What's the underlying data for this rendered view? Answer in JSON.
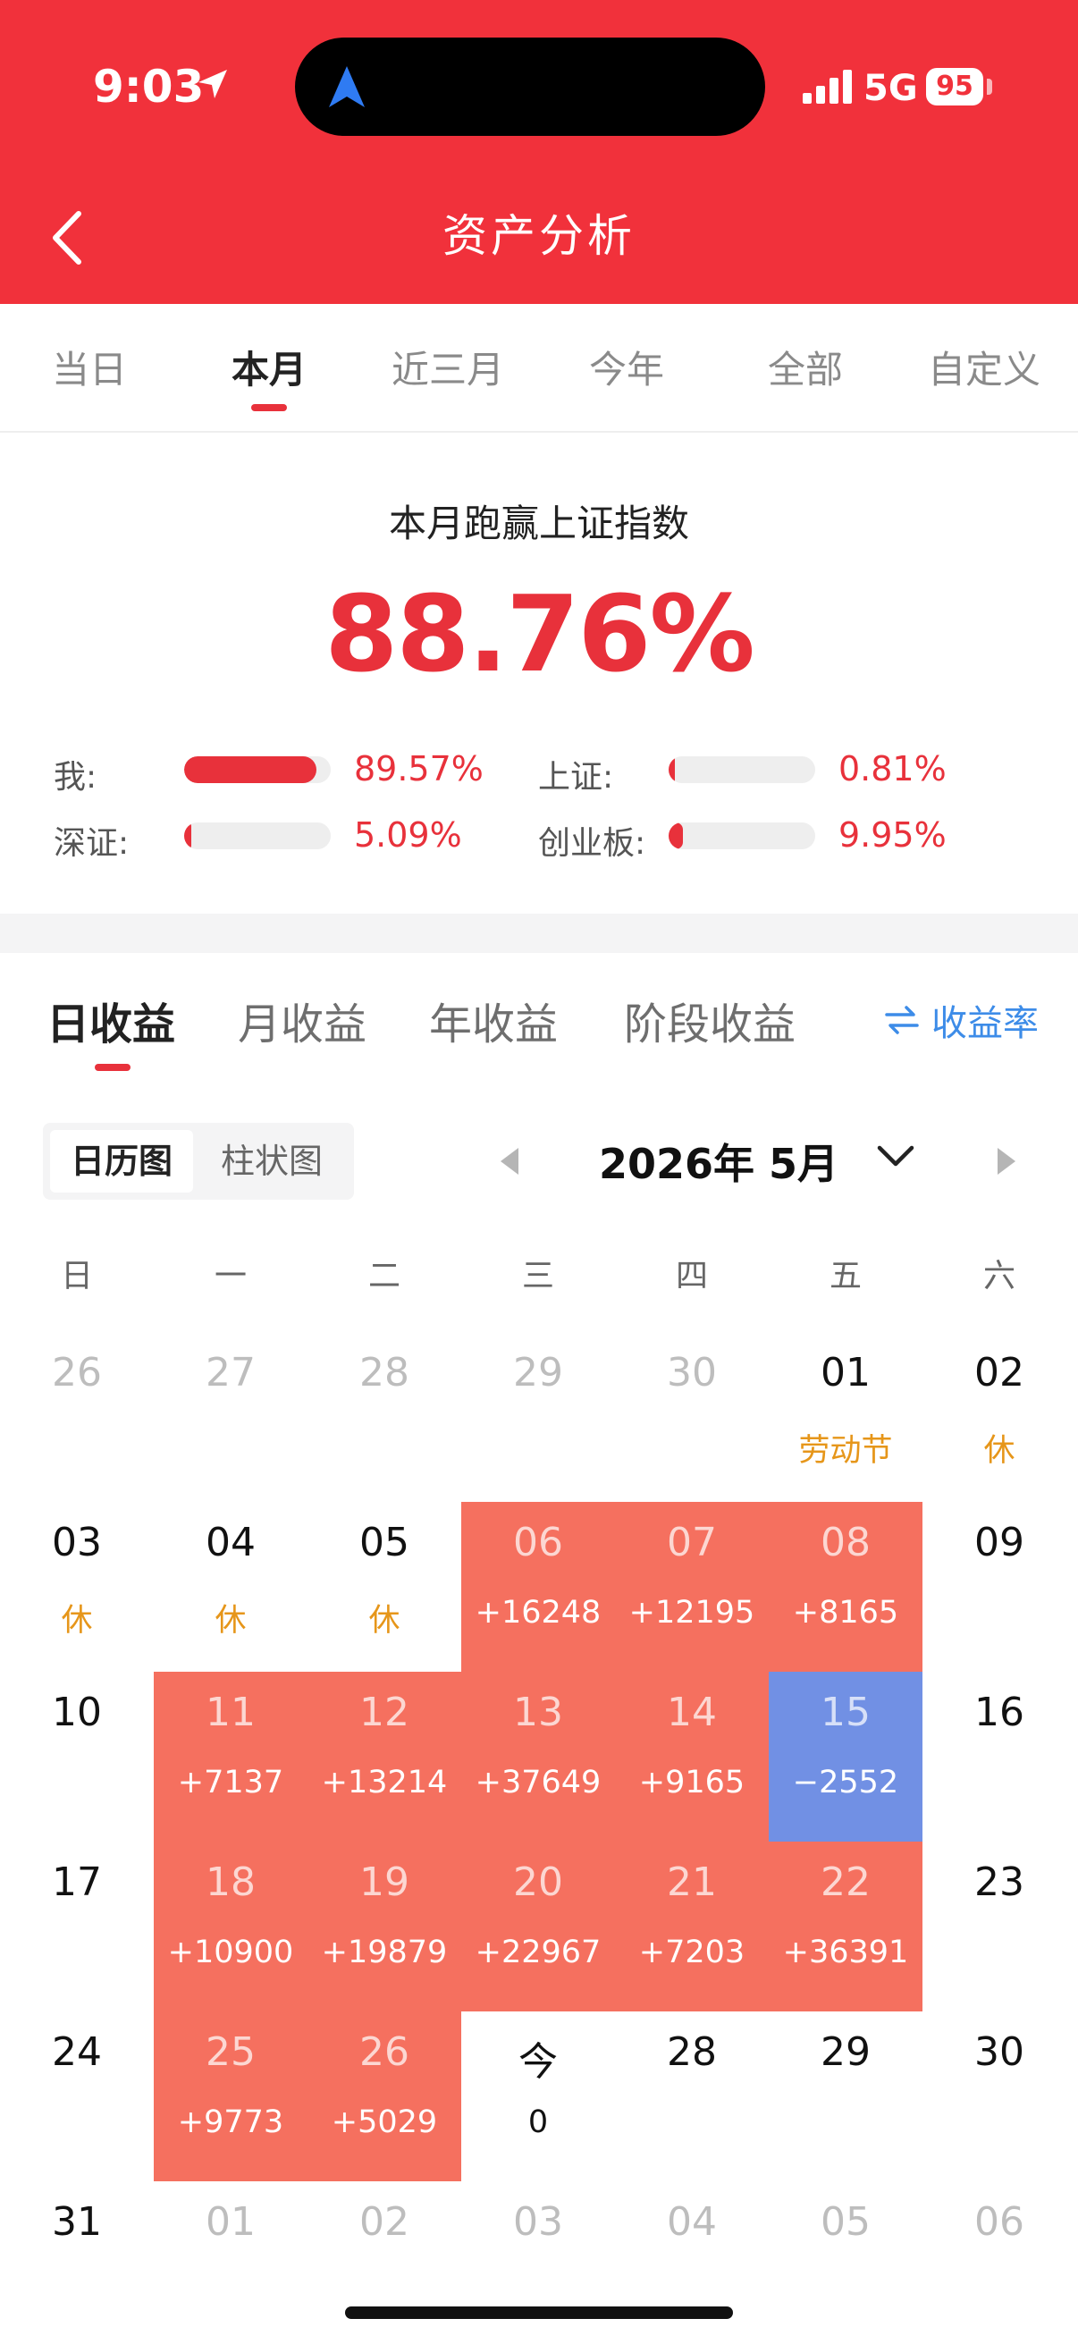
{
  "status_bar": {
    "time": "9:03",
    "network": "5G",
    "battery": "95"
  },
  "header": {
    "title": "资产分析"
  },
  "period_tabs": [
    {
      "label": "当日"
    },
    {
      "label": "本月",
      "active": true
    },
    {
      "label": "近三月"
    },
    {
      "label": "今年"
    },
    {
      "label": "全部"
    },
    {
      "label": "自定义"
    }
  ],
  "benchmark": {
    "title": "本月跑赢上证指数",
    "value": "88.76%",
    "comparisons": [
      {
        "label": "我:",
        "percent": "89.57%",
        "fill": 0.9
      },
      {
        "label": "上证:",
        "percent": "0.81%",
        "fill": 0.01
      },
      {
        "label": "深证:",
        "percent": "5.09%",
        "fill": 0.05
      },
      {
        "label": "创业板:",
        "percent": "9.95%",
        "fill": 0.1
      }
    ]
  },
  "earnings_tabs": [
    {
      "label": "日收益",
      "active": true
    },
    {
      "label": "月收益"
    },
    {
      "label": "年收益"
    },
    {
      "label": "阶段收益"
    }
  ],
  "rate_toggle": {
    "label": "收益率",
    "icon": "swap-icon"
  },
  "view_switch": [
    {
      "label": "日历图",
      "active": true
    },
    {
      "label": "柱状图"
    }
  ],
  "month_selector": {
    "label": "2026年 5月"
  },
  "weekdays": [
    "日",
    "一",
    "二",
    "三",
    "四",
    "五",
    "六"
  ],
  "calendar": [
    [
      {
        "day": "26",
        "sub": "",
        "kind": "other"
      },
      {
        "day": "27",
        "sub": "",
        "kind": "other"
      },
      {
        "day": "28",
        "sub": "",
        "kind": "other"
      },
      {
        "day": "29",
        "sub": "",
        "kind": "other"
      },
      {
        "day": "30",
        "sub": "",
        "kind": "other"
      },
      {
        "day": "01",
        "sub": "劳动节",
        "kind": "holiday"
      },
      {
        "day": "02",
        "sub": "休",
        "kind": "holiday"
      }
    ],
    [
      {
        "day": "03",
        "sub": "休",
        "kind": "holiday"
      },
      {
        "day": "04",
        "sub": "休",
        "kind": "holiday"
      },
      {
        "day": "05",
        "sub": "休",
        "kind": "holiday"
      },
      {
        "day": "06",
        "sub": "+16248",
        "kind": "gain"
      },
      {
        "day": "07",
        "sub": "+12195",
        "kind": "gain"
      },
      {
        "day": "08",
        "sub": "+8165",
        "kind": "gain"
      },
      {
        "day": "09",
        "sub": "",
        "kind": "normal"
      }
    ],
    [
      {
        "day": "10",
        "sub": "",
        "kind": "normal"
      },
      {
        "day": "11",
        "sub": "+7137",
        "kind": "gain"
      },
      {
        "day": "12",
        "sub": "+13214",
        "kind": "gain"
      },
      {
        "day": "13",
        "sub": "+37649",
        "kind": "gain"
      },
      {
        "day": "14",
        "sub": "+9165",
        "kind": "gain"
      },
      {
        "day": "15",
        "sub": "−2552",
        "kind": "loss"
      },
      {
        "day": "16",
        "sub": "",
        "kind": "normal"
      }
    ],
    [
      {
        "day": "17",
        "sub": "",
        "kind": "normal"
      },
      {
        "day": "18",
        "sub": "+10900",
        "kind": "gain"
      },
      {
        "day": "19",
        "sub": "+19879",
        "kind": "gain"
      },
      {
        "day": "20",
        "sub": "+22967",
        "kind": "gain"
      },
      {
        "day": "21",
        "sub": "+7203",
        "kind": "gain"
      },
      {
        "day": "22",
        "sub": "+36391",
        "kind": "gain"
      },
      {
        "day": "23",
        "sub": "",
        "kind": "normal"
      }
    ],
    [
      {
        "day": "24",
        "sub": "",
        "kind": "normal"
      },
      {
        "day": "25",
        "sub": "+9773",
        "kind": "gain"
      },
      {
        "day": "26",
        "sub": "+5029",
        "kind": "gain"
      },
      {
        "day": "今",
        "sub": "0",
        "kind": "today"
      },
      {
        "day": "28",
        "sub": "",
        "kind": "normal"
      },
      {
        "day": "29",
        "sub": "",
        "kind": "normal"
      },
      {
        "day": "30",
        "sub": "",
        "kind": "normal"
      }
    ],
    [
      {
        "day": "31",
        "sub": "",
        "kind": "normal"
      },
      {
        "day": "01",
        "sub": "",
        "kind": "other"
      },
      {
        "day": "02",
        "sub": "",
        "kind": "other"
      },
      {
        "day": "03",
        "sub": "",
        "kind": "other"
      },
      {
        "day": "04",
        "sub": "",
        "kind": "other"
      },
      {
        "day": "05",
        "sub": "",
        "kind": "other"
      },
      {
        "day": "06",
        "sub": "",
        "kind": "other"
      }
    ]
  ],
  "colors": {
    "brand_red": "#f1313b",
    "gain": "#f5705f",
    "loss": "#7190e4",
    "holiday": "#e6961a",
    "link_blue": "#3d8ce8"
  }
}
